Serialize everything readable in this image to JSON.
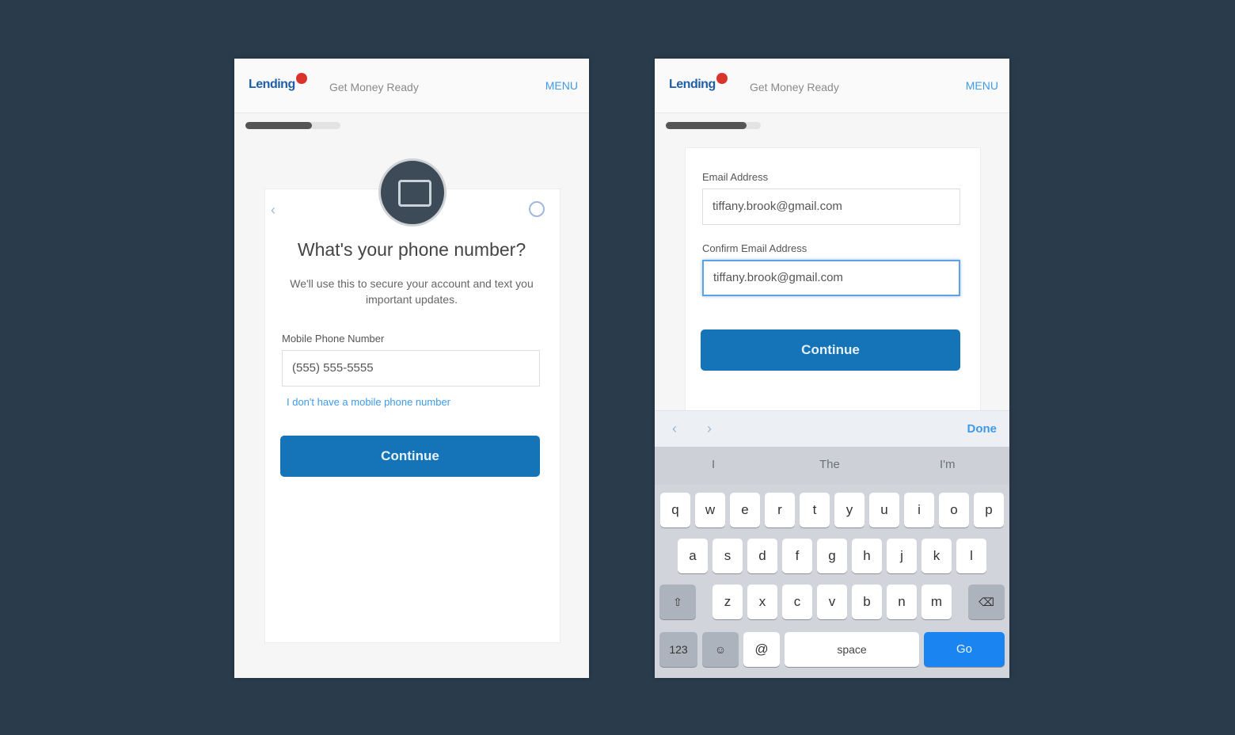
{
  "left_screen": {
    "brand": "Lending",
    "title": "Get Money Ready",
    "menu_link": "MENU",
    "progress": 0.7,
    "heading": "What's your phone number?",
    "subtitle": "We'll use this to secure your account and text you important updates.",
    "field_label": "Mobile Phone Number",
    "field_value": "(555) 555-5555",
    "link_text": "I don't have a mobile phone number",
    "continue_label": "Continue"
  },
  "right_screen": {
    "brand": "Lending",
    "title": "Get Money Ready",
    "menu_link": "MENU",
    "progress": 0.85,
    "email_label": "Email Address",
    "email_value": "tiffany.brook@gmail.com",
    "confirm_label": "Confirm Email Address",
    "confirm_value": "tiffany.brook@gmail.com",
    "continue_label": "Continue",
    "done_label": "Done",
    "suggestions": [
      "I",
      "The",
      "I'm"
    ],
    "keyboard_rows": [
      [
        "q",
        "w",
        "e",
        "r",
        "t",
        "y",
        "u",
        "i",
        "o",
        "p"
      ],
      [
        "a",
        "s",
        "d",
        "f",
        "g",
        "h",
        "j",
        "k",
        "l"
      ],
      [
        "z",
        "x",
        "c",
        "v",
        "b",
        "n",
        "m"
      ]
    ],
    "shift_label": "⇧",
    "delete_label": "⌫",
    "numbers_label": "123",
    "emoji_label": "☺",
    "at_label": "@",
    "space_label": "space",
    "go_label": "Go"
  }
}
